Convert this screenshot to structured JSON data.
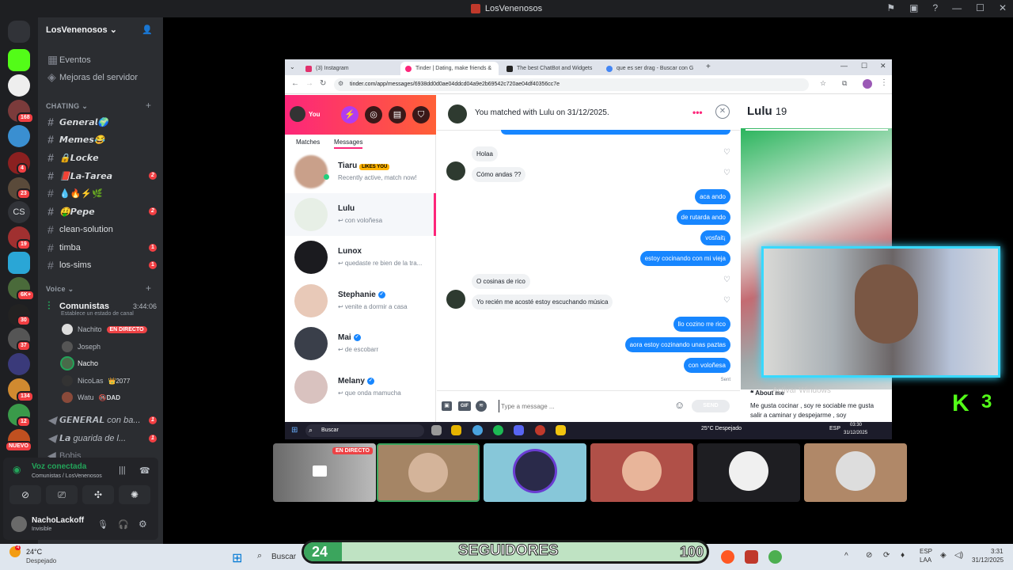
{
  "window": {
    "title": "LosVenenosos"
  },
  "server": {
    "name": "LosVenenosos",
    "menu": [
      {
        "label": "Eventos"
      },
      {
        "label": "Mejoras del servidor"
      }
    ],
    "categories": {
      "chatting": "CHATING",
      "voice": "Voice"
    },
    "text_channels": [
      {
        "label": "𝙂𝙚𝙣𝙚𝙧𝙖𝙡🌍",
        "badge": ""
      },
      {
        "label": "𝙈𝙚𝙢𝙚𝙨😂",
        "badge": ""
      },
      {
        "label": "🔒𝙇𝙤𝙘𝙠𝙚",
        "badge": ""
      },
      {
        "label": "📕𝙇𝙖-𝙏𝙖𝙧𝙚𝙖",
        "badge": "2"
      },
      {
        "label": "💧🔥⚡🌿",
        "badge": ""
      },
      {
        "label": "🤑𝙋𝙚𝙥𝙚",
        "badge": "2"
      },
      {
        "label": "clean-solution",
        "badge": ""
      },
      {
        "label": "timba",
        "badge": "1"
      },
      {
        "label": "los-sims",
        "badge": "1"
      }
    ],
    "voice_channel": {
      "name": "Comunistas",
      "timer": "3:44:06",
      "status": "Establece un estado de canal"
    },
    "members": [
      {
        "name": "Nachito",
        "tag": "EN DIRECTO"
      },
      {
        "name": "Joseph",
        "tag": ""
      },
      {
        "name": "Nacho",
        "tag": ""
      },
      {
        "name": "NicoLas",
        "tag": "👑2077"
      },
      {
        "name": "Watu",
        "tag": "🚳DAD"
      }
    ],
    "voice_channels_more": [
      {
        "label": "𝙂𝙀𝙉𝙀𝙍𝘼𝙇 con ba...",
        "badge": "1"
      },
      {
        "label": "𝙇𝙖 guarida de l...",
        "badge": "1"
      },
      {
        "label": "Bobis",
        "badge": "1"
      }
    ],
    "rail_badges": [
      "168",
      "4",
      "23",
      "CS",
      "19",
      "6K+",
      "30",
      "37",
      "134",
      "12",
      "NUEVO"
    ]
  },
  "voice": {
    "status": "Voz conectada",
    "location": "Comunistas / LosVenenosos"
  },
  "user": {
    "name": "NachoLackoff",
    "status": "Invisible"
  },
  "browser": {
    "tabs": [
      {
        "label": "(3) Instagram"
      },
      {
        "label": "Tinder | Dating, make friends &"
      },
      {
        "label": "The best ChatBot and Widgets"
      },
      {
        "label": "que es ser drag - Buscar con G"
      }
    ],
    "url": "tinder.com/app/messages/6938dd0d0ae04ddcd04a9e2b69542c720ae04df40356cc7e"
  },
  "tinder": {
    "you_label": "You",
    "tab_matches": "Matches",
    "tab_messages": "Messages",
    "conversations": [
      {
        "name": "Tiaru",
        "badge": "LIKES YOU",
        "preview": "Recently active, match now!",
        "verified": false
      },
      {
        "name": "Lulu",
        "badge": "",
        "preview": "↩ con voloñesa",
        "verified": false
      },
      {
        "name": "Lunox",
        "badge": "",
        "preview": "↩ quedaste re bien de la tra...",
        "verified": false
      },
      {
        "name": "Stephanie",
        "badge": "",
        "preview": "↩ venite a dormir a casa",
        "verified": true
      },
      {
        "name": "Mai",
        "badge": "",
        "preview": "↩ de escobarr",
        "verified": true
      },
      {
        "name": "Melany",
        "badge": "",
        "preview": "↩ que onda mamucha",
        "verified": true
      }
    ],
    "chat_header": "You matched with Lulu on 31/12/2025.",
    "messages_in": [
      {
        "text": "Holaa"
      },
      {
        "text": "Cómo andas ??"
      },
      {
        "text": "O cosinas  de rico"
      },
      {
        "text": "Yo recién me acosté estoy escuchando música"
      }
    ],
    "messages_out": [
      {
        "text": "aca ando"
      },
      {
        "text": "de rutarda ando"
      },
      {
        "text": "vosfait¡"
      },
      {
        "text": "estoy cocinando con mi vieja"
      },
      {
        "text": "llo cozino rre rico"
      },
      {
        "text": "aora estoy cozinando unas paztas"
      },
      {
        "text": "con voloñesa"
      }
    ],
    "sent_label": "Sent",
    "input_placeholder": "Type a message ...",
    "gif_label": "GIF",
    "send_label": "SEND",
    "profile": {
      "name": "Lulu",
      "age": "19",
      "about_title": "About me",
      "about_text": "Me gusta cocinar , soy re sociable me gusta salir a caminar y despejarme , soy",
      "watermark": "Activar Windows"
    }
  },
  "inner_taskbar": {
    "search": "Buscar",
    "weather": "25°C  Despejado",
    "lang": "ESP",
    "time": "03:30",
    "date": "31/12/2025"
  },
  "stream_tiles": {
    "live_label": "EN DIRECTO"
  },
  "overlay": {
    "kick_count": "3",
    "followers_count": "24",
    "followers_label": "SEGUIDORES",
    "goal": "100"
  },
  "windows_taskbar": {
    "weather_temp": "24°C",
    "weather_desc": "Despejado",
    "weather_badge": "4",
    "search": "Buscar",
    "lang": "ESP",
    "lang_region": "LAA",
    "time": "3:31",
    "date": "31/12/2025"
  },
  "colors": {
    "discord_bg": "#2b2d31",
    "tinder_pink": "#fd267a",
    "tinder_blue": "#1786ff",
    "kick_green": "#53fc18",
    "webcam_border": "#38d9ff"
  }
}
